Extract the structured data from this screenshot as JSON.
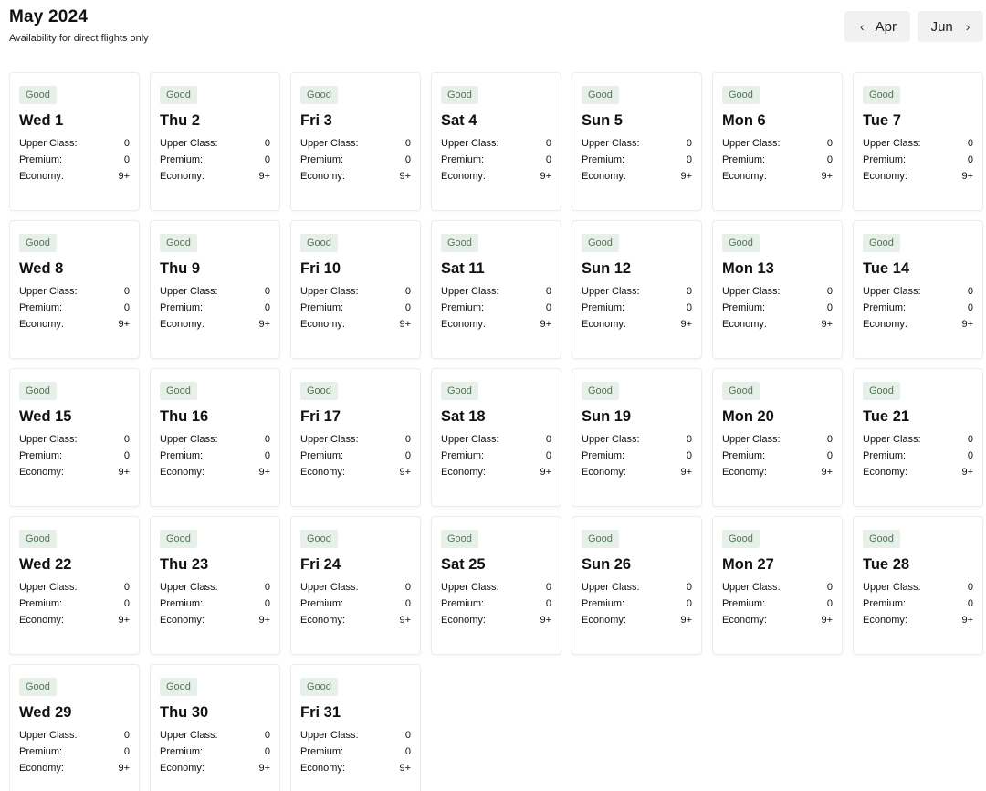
{
  "header": {
    "title": "May 2024",
    "subtitle": "Availability for direct flights only"
  },
  "nav": {
    "prev_label": "Apr",
    "next_label": "Jun",
    "prev_icon": "chevron-left-icon",
    "next_icon": "chevron-right-icon"
  },
  "labels": {
    "upper": "Upper Class:",
    "premium": "Premium:",
    "economy": "Economy:"
  },
  "colors": {
    "badge_bg": "#e7f0e8",
    "badge_text": "#4f7a55"
  },
  "days": [
    {
      "status": "Good",
      "day": "Wed 1",
      "upper": "0",
      "premium": "0",
      "economy": "9+"
    },
    {
      "status": "Good",
      "day": "Thu 2",
      "upper": "0",
      "premium": "0",
      "economy": "9+"
    },
    {
      "status": "Good",
      "day": "Fri 3",
      "upper": "0",
      "premium": "0",
      "economy": "9+"
    },
    {
      "status": "Good",
      "day": "Sat 4",
      "upper": "0",
      "premium": "0",
      "economy": "9+"
    },
    {
      "status": "Good",
      "day": "Sun 5",
      "upper": "0",
      "premium": "0",
      "economy": "9+"
    },
    {
      "status": "Good",
      "day": "Mon 6",
      "upper": "0",
      "premium": "0",
      "economy": "9+"
    },
    {
      "status": "Good",
      "day": "Tue 7",
      "upper": "0",
      "premium": "0",
      "economy": "9+"
    },
    {
      "status": "Good",
      "day": "Wed 8",
      "upper": "0",
      "premium": "0",
      "economy": "9+"
    },
    {
      "status": "Good",
      "day": "Thu 9",
      "upper": "0",
      "premium": "0",
      "economy": "9+"
    },
    {
      "status": "Good",
      "day": "Fri 10",
      "upper": "0",
      "premium": "0",
      "economy": "9+"
    },
    {
      "status": "Good",
      "day": "Sat 11",
      "upper": "0",
      "premium": "0",
      "economy": "9+"
    },
    {
      "status": "Good",
      "day": "Sun 12",
      "upper": "0",
      "premium": "0",
      "economy": "9+"
    },
    {
      "status": "Good",
      "day": "Mon 13",
      "upper": "0",
      "premium": "0",
      "economy": "9+"
    },
    {
      "status": "Good",
      "day": "Tue 14",
      "upper": "0",
      "premium": "0",
      "economy": "9+"
    },
    {
      "status": "Good",
      "day": "Wed 15",
      "upper": "0",
      "premium": "0",
      "economy": "9+"
    },
    {
      "status": "Good",
      "day": "Thu 16",
      "upper": "0",
      "premium": "0",
      "economy": "9+"
    },
    {
      "status": "Good",
      "day": "Fri 17",
      "upper": "0",
      "premium": "0",
      "economy": "9+"
    },
    {
      "status": "Good",
      "day": "Sat 18",
      "upper": "0",
      "premium": "0",
      "economy": "9+"
    },
    {
      "status": "Good",
      "day": "Sun 19",
      "upper": "0",
      "premium": "0",
      "economy": "9+"
    },
    {
      "status": "Good",
      "day": "Mon 20",
      "upper": "0",
      "premium": "0",
      "economy": "9+"
    },
    {
      "status": "Good",
      "day": "Tue 21",
      "upper": "0",
      "premium": "0",
      "economy": "9+"
    },
    {
      "status": "Good",
      "day": "Wed 22",
      "upper": "0",
      "premium": "0",
      "economy": "9+"
    },
    {
      "status": "Good",
      "day": "Thu 23",
      "upper": "0",
      "premium": "0",
      "economy": "9+"
    },
    {
      "status": "Good",
      "day": "Fri 24",
      "upper": "0",
      "premium": "0",
      "economy": "9+"
    },
    {
      "status": "Good",
      "day": "Sat 25",
      "upper": "0",
      "premium": "0",
      "economy": "9+"
    },
    {
      "status": "Good",
      "day": "Sun 26",
      "upper": "0",
      "premium": "0",
      "economy": "9+"
    },
    {
      "status": "Good",
      "day": "Mon 27",
      "upper": "0",
      "premium": "0",
      "economy": "9+"
    },
    {
      "status": "Good",
      "day": "Tue 28",
      "upper": "0",
      "premium": "0",
      "economy": "9+"
    },
    {
      "status": "Good",
      "day": "Wed 29",
      "upper": "0",
      "premium": "0",
      "economy": "9+"
    },
    {
      "status": "Good",
      "day": "Thu 30",
      "upper": "0",
      "premium": "0",
      "economy": "9+"
    },
    {
      "status": "Good",
      "day": "Fri 31",
      "upper": "0",
      "premium": "0",
      "economy": "9+"
    }
  ]
}
